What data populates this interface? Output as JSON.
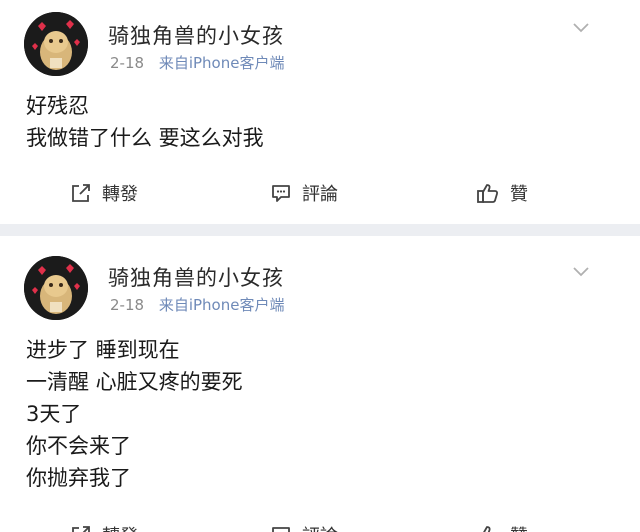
{
  "posts": [
    {
      "username": "骑独角兽的小女孩",
      "date": "2-18",
      "source": "来自iPhone客户端",
      "lines": [
        "好残忍",
        "我做错了什么 要这么对我"
      ],
      "actions": {
        "repost": "轉發",
        "comment": "評論",
        "like": "贊"
      }
    },
    {
      "username": "骑独角兽的小女孩",
      "date": "2-18",
      "source": "来自iPhone客户端",
      "lines": [
        "进步了 睡到现在",
        "一清醒 心脏又疼的要死",
        "3天了",
        "你不会来了",
        "你抛弃我了"
      ],
      "actions": {
        "repost": "轉發",
        "comment": "評論",
        "like": "贊"
      }
    }
  ],
  "icons": {
    "repost": "share-icon",
    "comment": "comment-icon",
    "like": "thumbs-up-icon",
    "menu": "chevron-down-icon"
  },
  "colors": {
    "source_link": "#6f8ab8",
    "meta_text": "#8a8a8a",
    "separator": "#eceef2"
  }
}
